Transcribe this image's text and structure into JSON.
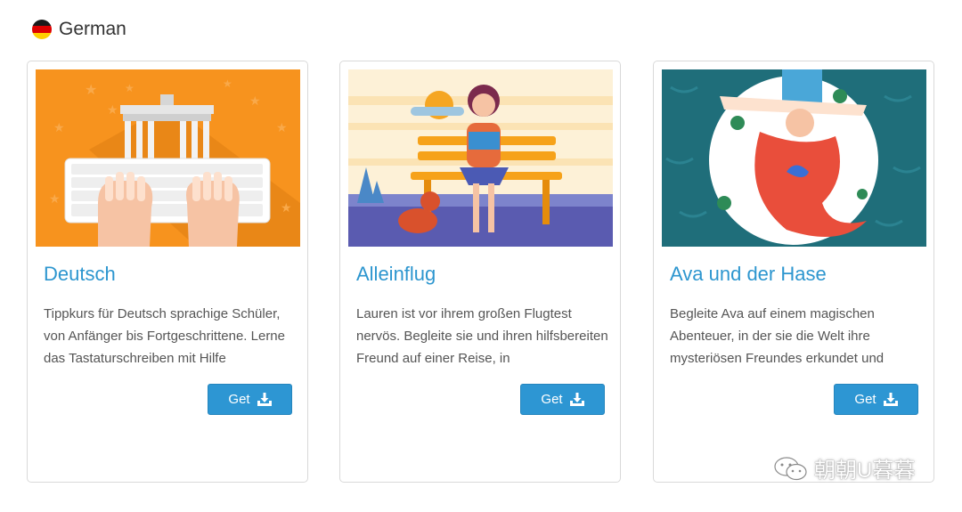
{
  "section": {
    "title": "German",
    "flag_colors": [
      "#000000",
      "#dd0000",
      "#ffce00"
    ]
  },
  "cards": [
    {
      "title": "Deutsch",
      "description": "Tippkurs für Deutsch sprachige Schüler, von Anfänger bis Fortgeschrittene. Lerne das Tastaturschreiben mit Hilfe",
      "button_label": "Get",
      "button_icon": "download-icon",
      "image": "brandenburg-gate-keyboard-illustration"
    },
    {
      "title": "Alleinflug",
      "description": "Lauren ist vor ihrem großen Flugtest nervös. Begleite sie und ihren hilfsbereiten Freund auf einer Reise, in",
      "button_label": "Get",
      "button_icon": "download-icon",
      "image": "girl-reading-on-bench-illustration"
    },
    {
      "title": "Ava und der Hase",
      "description": "Begleite Ava auf einem magischen Abenteuer, in der sie die Welt ihre mysteriösen Freundes erkundet und",
      "button_label": "Get",
      "button_icon": "download-icon",
      "image": "ava-and-rabbit-illustration"
    }
  ],
  "watermark": {
    "text": "朝朝U暮暮",
    "icon": "wechat-icon"
  },
  "colors": {
    "accent": "#2d96cf",
    "button": "#2d96d3"
  }
}
